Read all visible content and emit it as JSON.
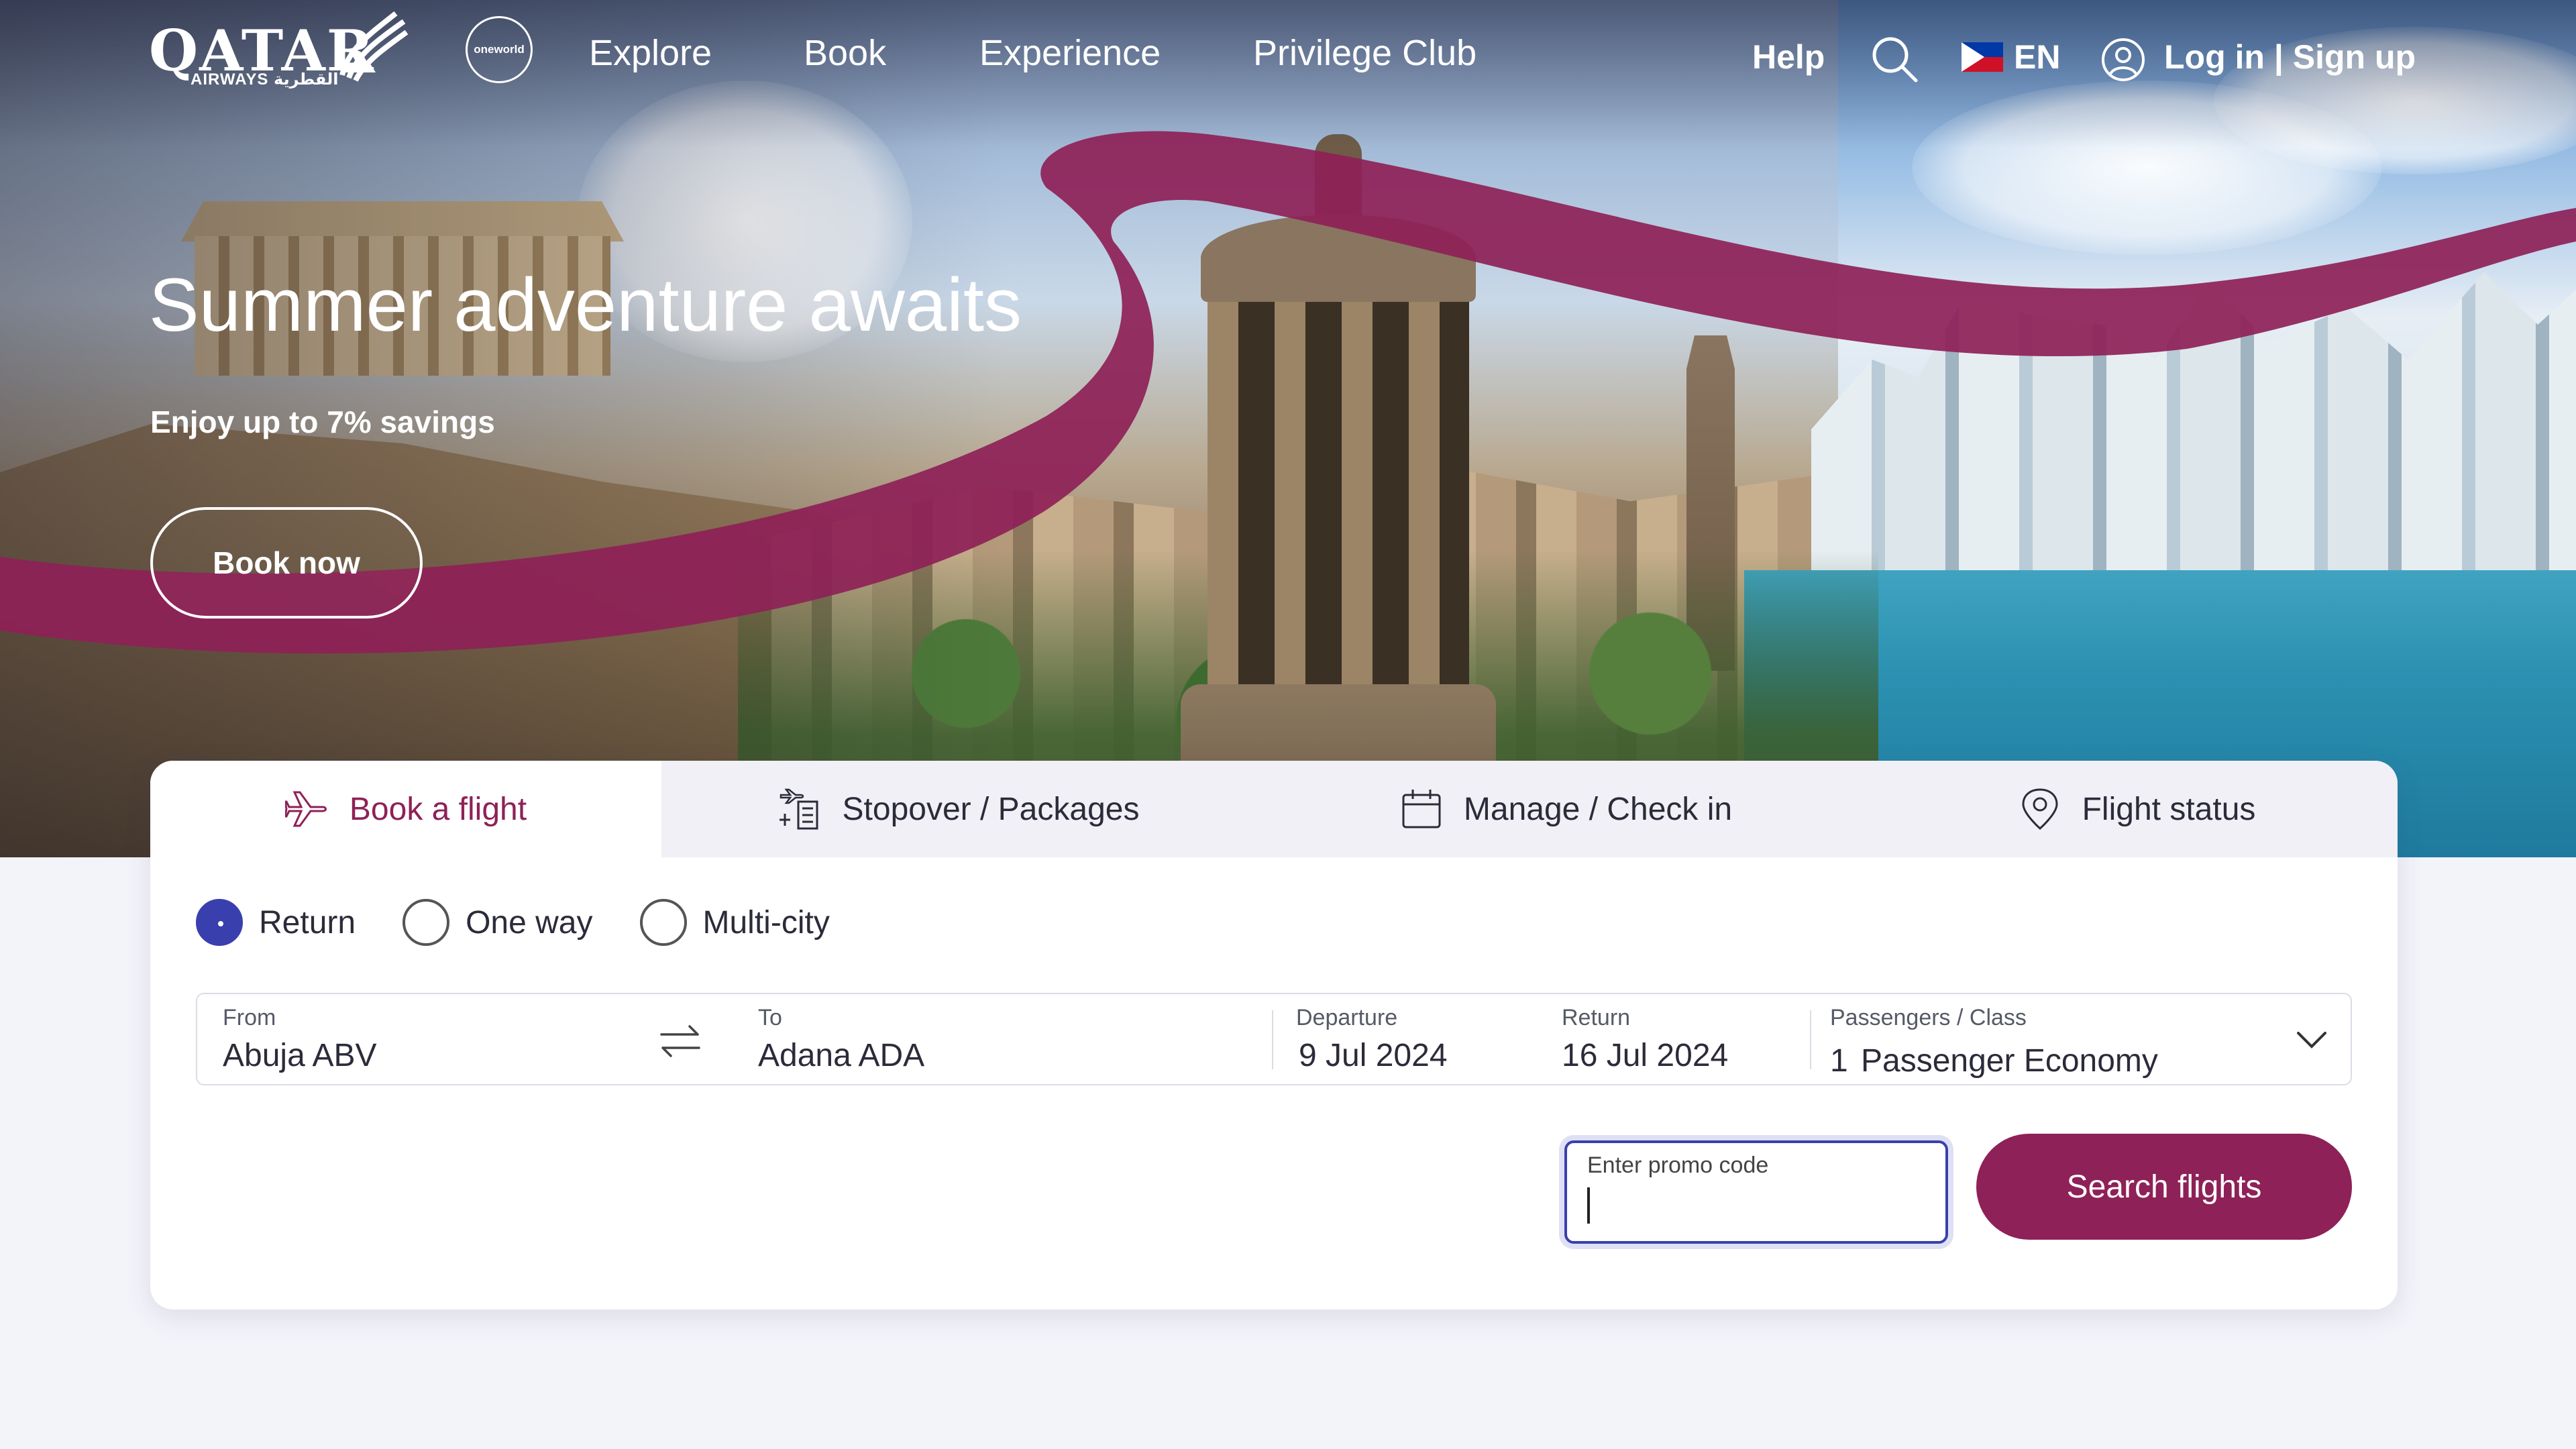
{
  "brand": {
    "logo_word": "QATAR",
    "logo_sub": "AIRWAYS القطرية",
    "alliance": "oneworld",
    "accent": "#8e2157",
    "focus": "#3a3fae"
  },
  "nav": {
    "items": [
      "Explore",
      "Book",
      "Experience",
      "Privilege Club"
    ],
    "help": "Help",
    "language": "EN",
    "login": "Log in | Sign up"
  },
  "hero": {
    "title": "Summer adventure awaits",
    "subtitle": "Enjoy up to 7% savings",
    "cta": "Book now"
  },
  "booking": {
    "tabs": [
      {
        "label": "Book a flight",
        "icon": "plane-icon",
        "active": true
      },
      {
        "label": "Stopover / Packages",
        "icon": "stopover-icon",
        "active": false
      },
      {
        "label": "Manage / Check in",
        "icon": "calendar-icon",
        "active": false
      },
      {
        "label": "Flight status",
        "icon": "location-pin-icon",
        "active": false
      }
    ],
    "trip_types": [
      {
        "label": "Return",
        "selected": true
      },
      {
        "label": "One way",
        "selected": false
      },
      {
        "label": "Multi-city",
        "selected": false
      }
    ],
    "from": {
      "label": "From",
      "value": "Abuja ABV"
    },
    "to": {
      "label": "To",
      "value": "Adana ADA"
    },
    "departure": {
      "label": "Departure",
      "value": "9 Jul 2024"
    },
    "return": {
      "label": "Return",
      "value": "16 Jul 2024"
    },
    "passengers": {
      "label": "Passengers / Class",
      "count": "1",
      "value": "Passenger Economy"
    },
    "promo": {
      "label": "Enter promo code",
      "value": ""
    },
    "search_label": "Search flights"
  }
}
